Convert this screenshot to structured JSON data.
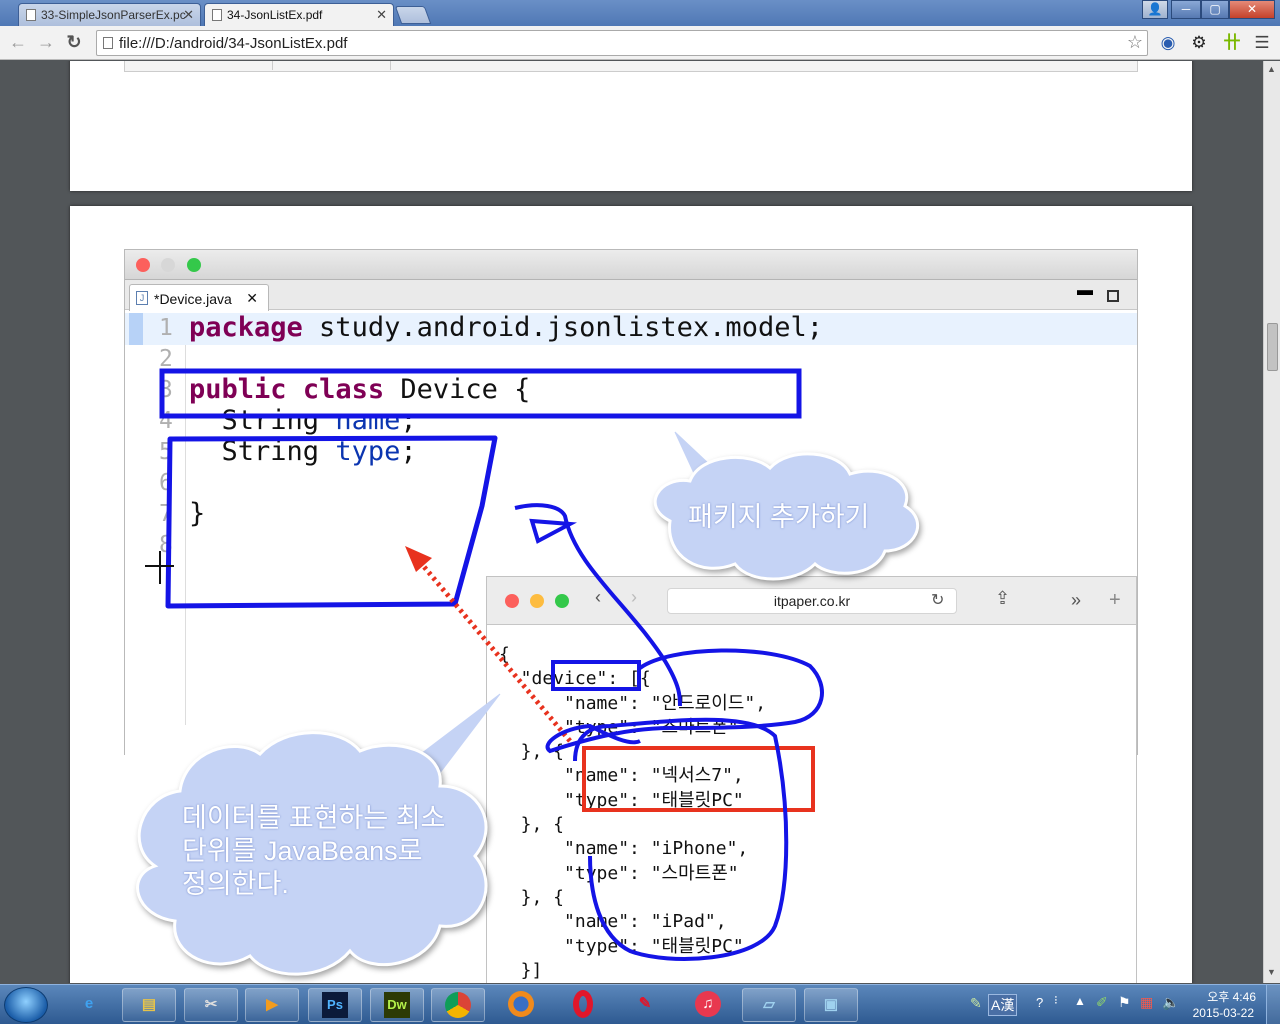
{
  "browser": {
    "tabs": [
      {
        "title": "33-SimpleJsonParserEx.pc",
        "active": false
      },
      {
        "title": "34-JsonListEx.pdf",
        "active": true
      }
    ],
    "address": "file:///D:/android/34-JsonListEx.pdf",
    "window_buttons": {
      "minimize": "─",
      "maximize": "▢",
      "close": "✕"
    }
  },
  "eclipse": {
    "file_tab": "*Device.java",
    "line_numbers": [
      "1",
      "2",
      "3",
      "4",
      "5",
      "6",
      "7",
      "8"
    ],
    "code": {
      "l1_kw": "package",
      "l1_rest": " study.android.jsonlistex.model;",
      "l3_kw1": "public",
      "l3_kw2": "class",
      "l3_rest": " Device {",
      "l4_type": "  String ",
      "l4_field": "name",
      "l4_end": ";",
      "l5_type": "  String ",
      "l5_field": "type",
      "l5_end": ";",
      "l7": "}"
    }
  },
  "safari": {
    "url": "itpaper.co.kr",
    "json_lines": [
      "{",
      "  \"device\": [{",
      "      \"name\": \"안드로이드\",",
      "      \"type\": \"스마트폰\"",
      "  }, {",
      "      \"name\": \"넥서스7\",",
      "      \"type\": \"태블릿PC\"",
      "  }, {",
      "      \"name\": \"iPhone\",",
      "      \"type\": \"스마트폰\"",
      "  }, {",
      "      \"name\": \"iPad\",",
      "      \"type\": \"태블릿PC\"",
      "  }]",
      "}"
    ]
  },
  "callouts": {
    "package": "패키지 추가하기",
    "javabeans_lines": [
      "데이터를 표현하는 최소",
      "단위를 JavaBeans로",
      "정의한다."
    ]
  },
  "taskbar": {
    "apps": [
      "internet-explorer",
      "file-explorer",
      "snipping-tool",
      "media-player",
      "photoshop",
      "dreamweaver",
      "chrome",
      "firefox",
      "opera",
      "unknown-app",
      "itunes",
      "notepad",
      "photo-viewer"
    ],
    "ps_label": "Ps",
    "dw_label": "Dw",
    "ime_label": "A漢",
    "time": "오후 4:46",
    "date": "2015-03-22"
  },
  "colors": {
    "annotation_blue": "#1414e6",
    "annotation_red": "#e8321e",
    "cloud_fill": "#c5d3f5",
    "keyword": "#7f0055",
    "field": "#0b35b0"
  }
}
